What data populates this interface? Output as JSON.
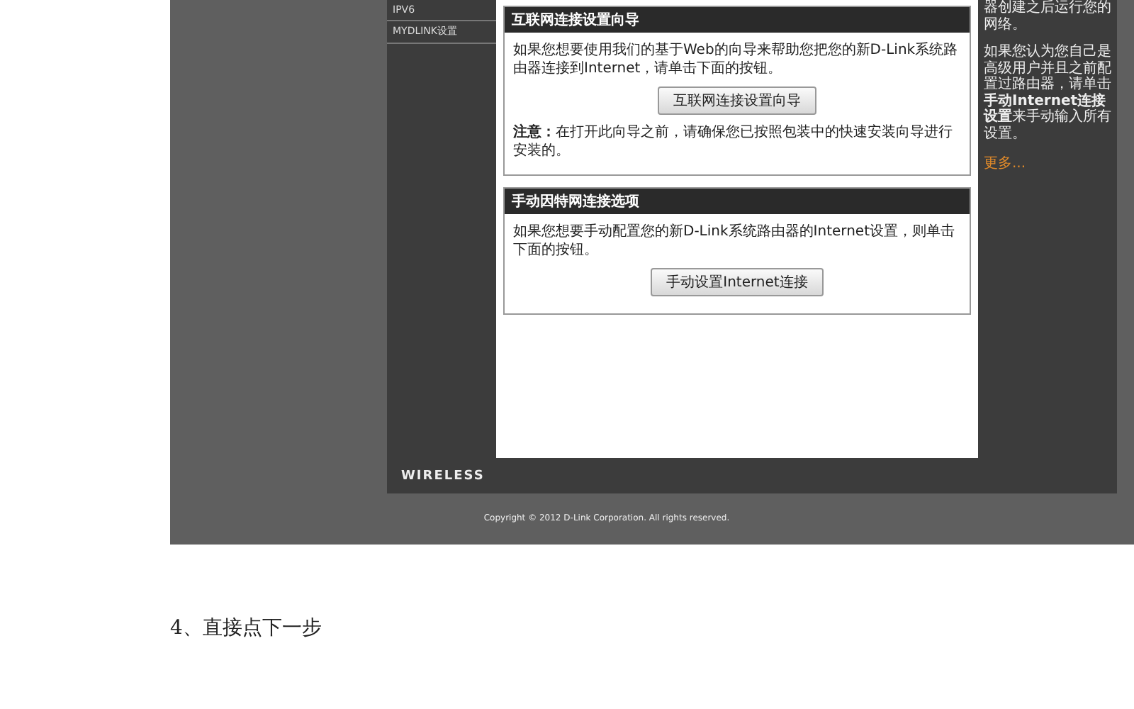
{
  "sidebar": {
    "items": [
      "IPV6",
      "MYDLINK设置"
    ]
  },
  "sections": [
    {
      "title": "互联网连接设置向导",
      "text": "如果您想要使用我们的基于Web的向导来帮助您把您的新D-Link系统路由器连接到Internet，请单击下面的按钮。",
      "button": "互联网连接设置向导",
      "note": "**注意：**在打开此向导之前，请确保您已按照包装中的快速安装向导进行安装的。"
    },
    {
      "title": "手动因特网连接选项",
      "text": "如果您想要手动配置您的新D-Link系统路由器的Internet设置，则单击下面的按钮。",
      "button": "手动设置Internet连接"
    }
  ],
  "help": {
    "paragraphs": [
      "器创建之后运行您的网络。",
      "如果您认为您自己是高级用户并且之前配置过路由器，请单击**手动Internet连接设置**来手动输入所有设置。"
    ],
    "more": "更多..."
  },
  "footer": {
    "logo": "WIRELESS",
    "copyright": "Copyright © 2012 D-Link Corporation. All rights reserved."
  },
  "caption": "4、直接点下一步"
}
